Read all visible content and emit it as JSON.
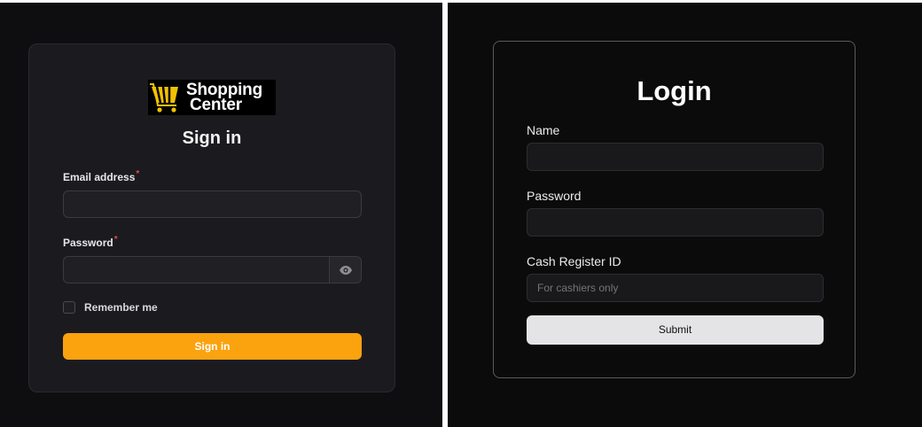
{
  "left_form": {
    "logo": {
      "line1": "Shopping",
      "line2": "Center",
      "icon": "shopping-cart-icon"
    },
    "title": "Sign in",
    "email_label": "Email address",
    "password_label": "Password",
    "required_mark": "*",
    "password_toggle_icon": "eye-icon",
    "remember_label": "Remember me",
    "remember_checked": false,
    "submit_label": "Sign in",
    "accent_color": "#fba20f"
  },
  "right_form": {
    "title": "Login",
    "name_label": "Name",
    "password_label": "Password",
    "cash_register_label": "Cash Register ID",
    "cash_register_placeholder": "For cashiers only",
    "submit_label": "Submit"
  }
}
